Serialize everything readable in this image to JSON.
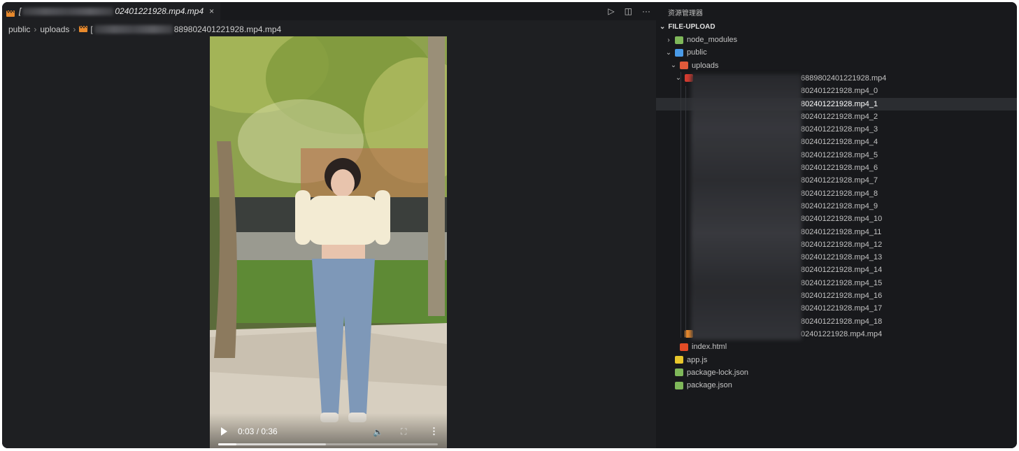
{
  "tab": {
    "prefix": "[",
    "suffix": "02401221928.mp4.mp4",
    "close": "×"
  },
  "tab_actions": {
    "run": "▷",
    "split": "◫",
    "more": "···"
  },
  "breadcrumb": {
    "items": [
      "public",
      "uploads"
    ],
    "file_prefix": "[",
    "file_suffix": "889802401221928.mp4.mp4"
  },
  "video": {
    "time": "0:03 / 0:36",
    "progress_fraction": 0.083
  },
  "explorer": {
    "title": "资源管理器",
    "section": "FILE-UPLOAD",
    "rows": [
      {
        "label": "node_modules",
        "chev": "›",
        "icon": "folder-node-icon",
        "color": "#7fb85a"
      },
      {
        "label": "public",
        "chev": "⌄",
        "icon": "folder-public-icon",
        "color": "#4a9be8"
      },
      {
        "label": "uploads",
        "chev": "⌄",
        "icon": "folder-uploads-icon",
        "color": "#e05a3a"
      },
      {
        "label": "6889802401221928.mp4",
        "chev": "⌄",
        "icon": "folder-video-icon",
        "color": "#d33b30"
      },
      {
        "label": "802401221928.mp4_0"
      },
      {
        "label": "802401221928.mp4_1",
        "selected": true
      },
      {
        "label": "802401221928.mp4_2"
      },
      {
        "label": "802401221928.mp4_3"
      },
      {
        "label": "802401221928.mp4_4"
      },
      {
        "label": "802401221928.mp4_5"
      },
      {
        "label": "802401221928.mp4_6"
      },
      {
        "label": "802401221928.mp4_7"
      },
      {
        "label": "802401221928.mp4_8"
      },
      {
        "label": "802401221928.mp4_9"
      },
      {
        "label": "802401221928.mp4_10"
      },
      {
        "label": "802401221928.mp4_11"
      },
      {
        "label": "802401221928.mp4_12"
      },
      {
        "label": "802401221928.mp4_13"
      },
      {
        "label": "802401221928.mp4_14"
      },
      {
        "label": "802401221928.mp4_15"
      },
      {
        "label": "802401221928.mp4_16"
      },
      {
        "label": "802401221928.mp4_17"
      },
      {
        "label": "802401221928.mp4_18"
      },
      {
        "label": "02401221928.mp4.mp4",
        "icon": "video-file-icon",
        "color": "#e8892c"
      },
      {
        "label": "index.html",
        "icon": "html-icon",
        "color": "#e34c26"
      },
      {
        "label": "app.js",
        "icon": "js-icon",
        "color": "#e8c72c"
      },
      {
        "label": "package-lock.json",
        "icon": "npm-json-icon",
        "color": "#7fb85a"
      },
      {
        "label": "package.json",
        "icon": "npm-json-icon",
        "color": "#7fb85a"
      }
    ]
  }
}
